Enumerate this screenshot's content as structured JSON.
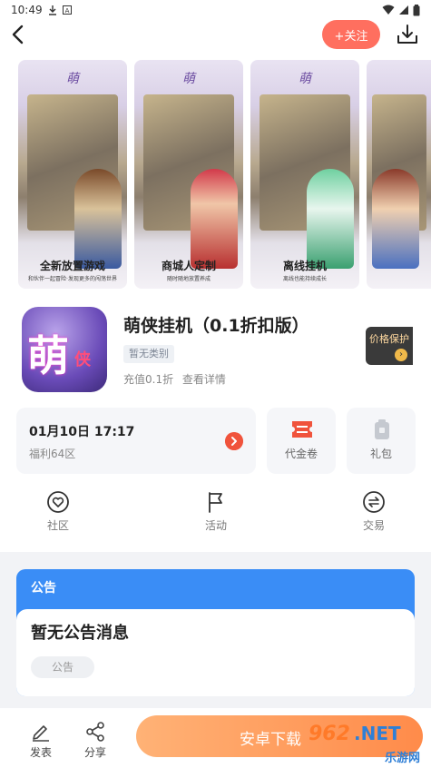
{
  "status_bar": {
    "time": "10:49"
  },
  "header": {
    "follow_label": "+关注"
  },
  "screenshots": [
    {
      "caption": "全新放置游戏",
      "subcaption": "和伙伴一起冒险·发现更多的闯荡世界"
    },
    {
      "caption": "商城人定制",
      "subcaption": "随时随地放置养成"
    },
    {
      "caption": "离线挂机",
      "subcaption": "离线也能持续成长"
    },
    {
      "caption": "",
      "subcaption": ""
    }
  ],
  "app": {
    "icon_text_main": "萌",
    "icon_text_sub": "侠",
    "title": "萌侠挂机（0.1折扣版）",
    "category": "暂无类别",
    "recharge": "充值0.1折",
    "details_link": "查看详情",
    "price_badge": "价格保护"
  },
  "server": {
    "time": "01月10日 17:17",
    "zone": "福利64区"
  },
  "quick_cards": [
    {
      "label": "代金卷",
      "icon": "voucher-icon"
    },
    {
      "label": "礼包",
      "icon": "gift-icon"
    }
  ],
  "nav": [
    {
      "label": "社区",
      "icon": "community-icon"
    },
    {
      "label": "活动",
      "icon": "flag-icon"
    },
    {
      "label": "交易",
      "icon": "exchange-icon"
    }
  ],
  "notice": {
    "title": "公告",
    "message": "暂无公告消息",
    "tag": "公告"
  },
  "bottom": {
    "post_label": "发表",
    "share_label": "分享",
    "download_label": "安卓下载"
  },
  "watermark": {
    "brand": "962",
    "suffix": ".NET",
    "site": "乐游网"
  },
  "colors": {
    "accent": "#ff6f5f",
    "notice_blue": "#3a8df6",
    "download_start": "#ffb276",
    "download_end": "#ff8b4a"
  }
}
